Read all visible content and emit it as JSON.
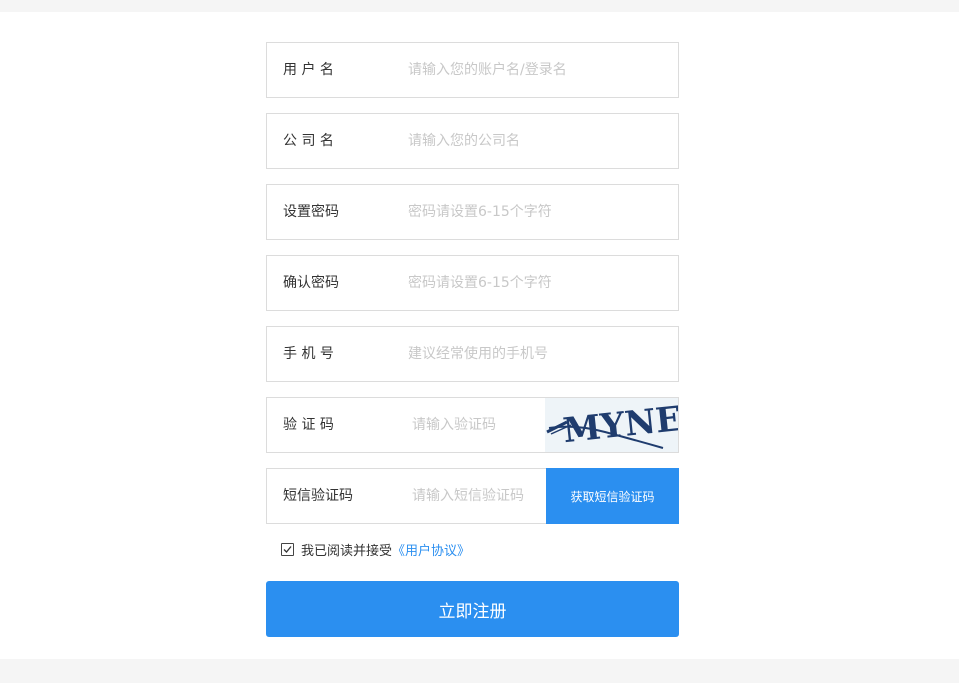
{
  "form": {
    "username": {
      "label": "用 户 名",
      "placeholder": "请输入您的账户名/登录名"
    },
    "company": {
      "label": "公 司 名",
      "placeholder": "请输入您的公司名"
    },
    "password": {
      "label": "设置密码",
      "placeholder": "密码请设置6-15个字符"
    },
    "confirm_password": {
      "label": "确认密码",
      "placeholder": "密码请设置6-15个字符"
    },
    "phone": {
      "label": "手 机 号",
      "placeholder": "建议经常使用的手机号"
    },
    "captcha": {
      "label": "验 证 码",
      "placeholder": "请输入验证码",
      "image_text": "MYNE"
    },
    "sms_code": {
      "label": "短信验证码",
      "placeholder": "请输入短信验证码",
      "button_label": "获取短信验证码"
    }
  },
  "agreement": {
    "text": "我已阅读并接受",
    "link_text": "《用户协议》",
    "checked": true
  },
  "submit_label": "立即注册",
  "colors": {
    "accent": "#2b8ff0",
    "border": "#dcdcdc",
    "captcha_text": "#1f3c6e"
  }
}
